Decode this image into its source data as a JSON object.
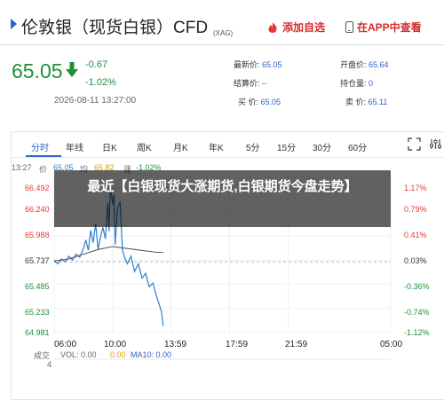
{
  "header": {
    "title": "伦敦银（现货白银）CFD",
    "code": "(XAG)",
    "favorite_label": "添加自选",
    "app_label": "在APP中查看"
  },
  "quote": {
    "price": "65.05",
    "change": "-0.67",
    "change_pct": "-1.02%",
    "timestamp": "2026-08-11 13:27:00",
    "stats": {
      "latest_label": "最新价:",
      "latest": "65.05",
      "open_label": "开盘价:",
      "open": "65.64",
      "settle_label": "结算价:",
      "settle": "--",
      "position_label": "持仓量:",
      "position": "0",
      "buy_label": "买  价:",
      "buy": "65.05",
      "sell_label": "卖  价:",
      "sell": "65.11"
    }
  },
  "chart_tabs": [
    {
      "label": "分时"
    },
    {
      "label": "年线"
    },
    {
      "label": "日K"
    },
    {
      "label": "周K"
    },
    {
      "label": "月K"
    },
    {
      "label": "年K"
    },
    {
      "label": "5分"
    },
    {
      "label": "15分"
    },
    {
      "label": "30分"
    },
    {
      "label": "60分"
    }
  ],
  "chart_legend": {
    "time": "13:27",
    "price_label": "价",
    "price": "65.05",
    "avg_label": "均",
    "avg": "65.82",
    "pct_label": "涨",
    "pct": "-1.02%"
  },
  "overlay": {
    "text": "最近【白银现货大涨期货,白银期货今盘走势】"
  },
  "volume": {
    "label": "成交",
    "value_axis": "4",
    "vol_text": "VOL: 0.00",
    "ma5_text": "0.00",
    "ma10_text": "MA10: 0.00"
  },
  "colors": {
    "up": "#e53935",
    "down": "#1f8f3a",
    "accent": "#2e63c8",
    "price_line": "#2c7fd1",
    "avg_line": "#5a5a5a"
  },
  "chart_data": {
    "type": "line",
    "title": "",
    "x_ticks": [
      "06:00",
      "10:00",
      "13:59",
      "17:59",
      "21:59",
      "05:00"
    ],
    "y_left_ticks": [
      "66.492",
      "66.240",
      "65.988",
      "65.737",
      "65.485",
      "65.233",
      "64.981"
    ],
    "y_right_ticks": [
      "1.17%",
      "0.79%",
      "0.41%",
      "0.03%",
      "-0.36%",
      "-0.74%",
      "-1.12%"
    ],
    "ylim": [
      64.981,
      66.492
    ],
    "reference": 65.72,
    "series": [
      {
        "key": "price",
        "times": [
          "06:00",
          "06:15",
          "06:30",
          "06:45",
          "07:00",
          "07:15",
          "07:30",
          "07:45",
          "08:00",
          "08:10",
          "08:20",
          "08:30",
          "08:40",
          "08:50",
          "09:00",
          "09:10",
          "09:20",
          "09:30",
          "09:40",
          "09:45",
          "09:50",
          "10:00",
          "10:05",
          "10:10",
          "10:20",
          "10:30",
          "10:40",
          "10:50",
          "11:00",
          "11:15",
          "11:30",
          "11:45",
          "12:00",
          "12:15",
          "12:30",
          "12:45",
          "13:00",
          "13:10",
          "13:20",
          "13:27"
        ],
        "values": [
          65.73,
          65.7,
          65.75,
          65.72,
          65.78,
          65.74,
          65.8,
          65.77,
          65.86,
          65.95,
          65.84,
          66.05,
          65.92,
          66.12,
          65.85,
          65.98,
          66.08,
          65.96,
          66.34,
          66.04,
          66.52,
          66.32,
          66.42,
          65.9,
          66.28,
          66.35,
          65.84,
          65.76,
          65.7,
          65.78,
          65.62,
          65.7,
          65.55,
          65.6,
          65.46,
          65.5,
          65.36,
          65.28,
          65.2,
          65.05
        ]
      },
      {
        "key": "avg",
        "times": [
          "06:00",
          "07:00",
          "08:00",
          "09:00",
          "10:00",
          "11:00",
          "12:00",
          "13:00",
          "13:27"
        ],
        "values": [
          65.73,
          65.75,
          65.8,
          65.85,
          65.88,
          65.86,
          65.84,
          65.82,
          65.82
        ]
      }
    ]
  }
}
